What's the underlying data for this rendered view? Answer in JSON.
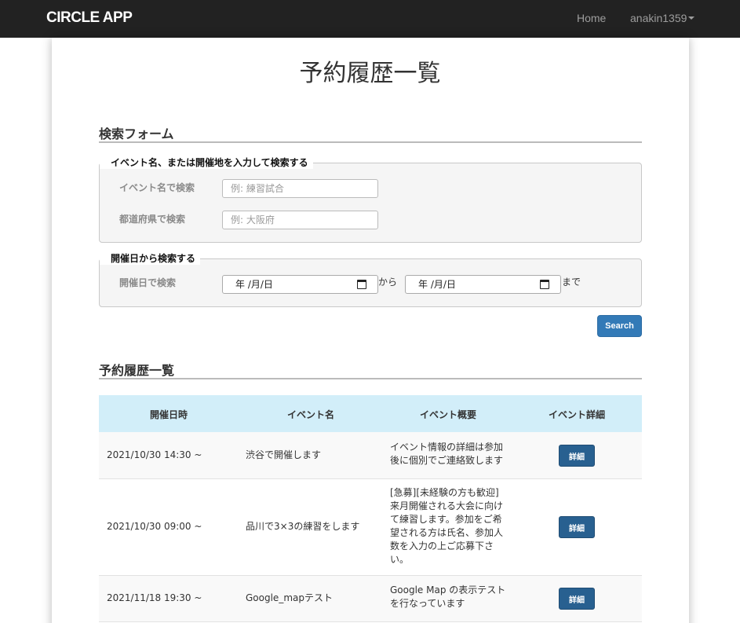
{
  "navbar": {
    "brand": "CIRCLE APP",
    "home_label": "Home",
    "user_label": "anakin1359"
  },
  "page_title": "予約履歴一覧",
  "search_form": {
    "heading": "検索フォーム",
    "name_group": {
      "legend": "イベント名、または開催地を入力して検索する",
      "event_label": "イベント名で検索",
      "event_placeholder": "例: 練習試合",
      "event_value": "",
      "pref_label": "都道府県で検索",
      "pref_placeholder": "例: 大阪府",
      "pref_value": ""
    },
    "date_group": {
      "legend": "開催日から検索する",
      "date_label": "開催日で検索",
      "from_value": "年 /月/日",
      "from_sep": "から",
      "to_value": "年 /月/日",
      "to_sep": "まで"
    },
    "search_button": "Search"
  },
  "history": {
    "heading": "予約履歴一覧",
    "columns": [
      "開催日時",
      "イベント名",
      "イベント概要",
      "イベント詳細"
    ],
    "rows": [
      {
        "date": "2021/10/30 14:30 ~",
        "name": "渋谷で開催します",
        "summary": "イベント情報の詳細は参加\n後に個別でご連絡致します",
        "detail": "詳細"
      },
      {
        "date": "2021/10/30 09:00 ~",
        "name": "品川で3×3の練習をします",
        "summary": "[急募][未経験の方も歓迎]\n来月開催される大会に向け\nて練習します。参加をご希\n望される方は氏名、参加人\n数を入力の上ご応募下さ\nい。",
        "detail": "詳細"
      },
      {
        "date": "2021/11/18 19:30 ~",
        "name": "Google_mapテスト",
        "summary": "Google Map の表示テスト\nを行なっています",
        "detail": "詳細"
      }
    ]
  },
  "colors": {
    "navbar_bg": "#222222",
    "primary": "#337ab7",
    "table_header_bg": "#d2eef9"
  }
}
